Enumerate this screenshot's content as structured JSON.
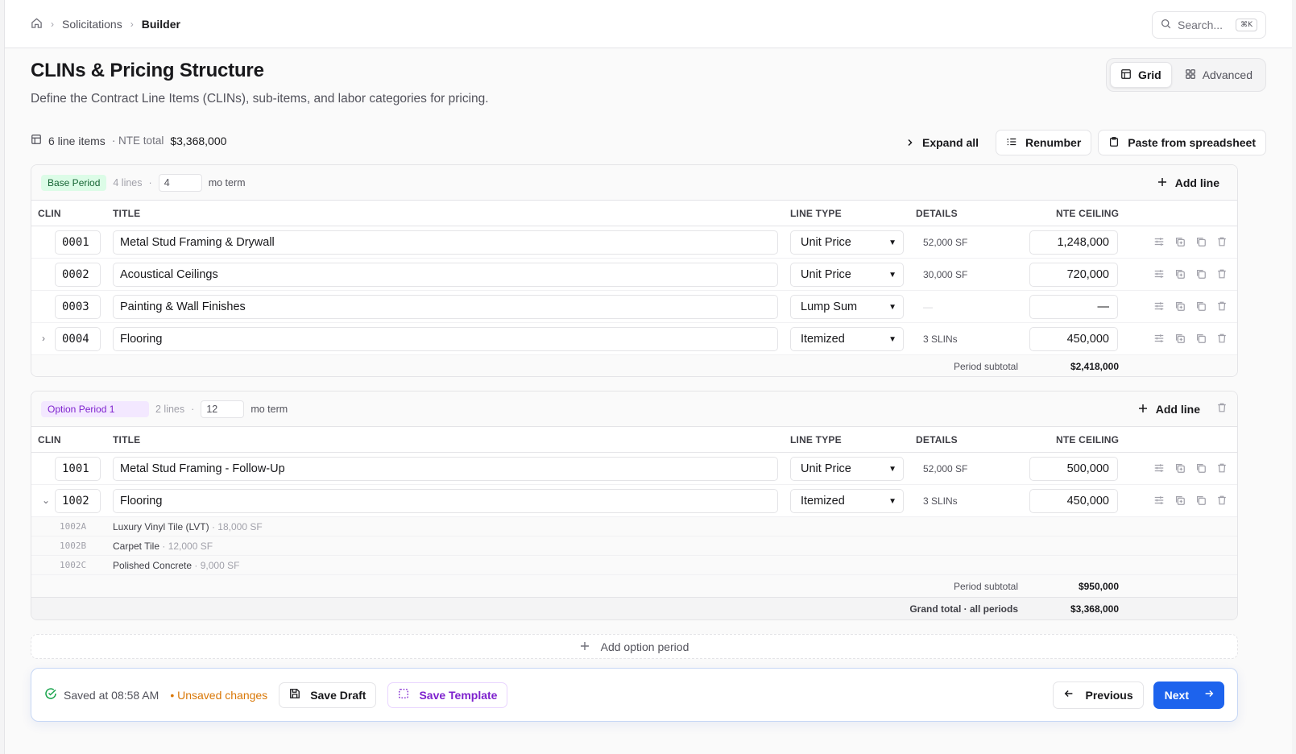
{
  "breadcrumbs": [
    "Solicitations",
    "Builder"
  ],
  "search": {
    "placeholder": "Search...",
    "shortcut": "⌘K"
  },
  "page": {
    "title": "CLINs & Pricing Structure",
    "subtitle": "Define the Contract Line Items (CLINs), sub-items, and labor categories for pricing."
  },
  "view_toggle": {
    "grid": "Grid",
    "advanced": "Advanced",
    "active": "grid"
  },
  "summary": {
    "line_items": "6 line items",
    "nte_label": "· NTE total",
    "nte_total": "$3,368,000"
  },
  "actions": {
    "expand_all": "Expand all",
    "renumber": "Renumber",
    "paste": "Paste from spreadsheet"
  },
  "columns": {
    "clin": "CLIN",
    "title": "TITLE",
    "line_type": "LINE TYPE",
    "details": "DETAILS",
    "nte": "NTE CEILING"
  },
  "base_period": {
    "label": "Base Period",
    "lines": "4 lines",
    "dot": "·",
    "term": "4",
    "term_unit": "mo term",
    "add_line": "Add line",
    "rows": [
      {
        "clin": "0001",
        "title": "Metal Stud Framing & Drywall",
        "line_type": "Unit Price",
        "details": "52,000 SF",
        "nte": "1,248,000"
      },
      {
        "clin": "0002",
        "title": "Acoustical Ceilings",
        "line_type": "Unit Price",
        "details": "30,000 SF",
        "nte": "720,000"
      },
      {
        "clin": "0003",
        "title": "Painting & Wall Finishes",
        "line_type": "Lump Sum",
        "details": "—",
        "nte": "—"
      },
      {
        "clin": "0004",
        "title": "Flooring",
        "line_type": "Itemized",
        "details": "3 SLINs",
        "nte": "450,000"
      }
    ],
    "subtotal_label": "Period subtotal",
    "subtotal": "$2,418,000"
  },
  "option_period": {
    "label": "Option Period 1",
    "lines": "2 lines",
    "dot": "·",
    "term": "12",
    "term_unit": "mo term",
    "add_line": "Add line",
    "rows": [
      {
        "clin": "1001",
        "title": "Metal Stud Framing - Follow-Up",
        "line_type": "Unit Price",
        "details": "52,000 SF",
        "nte": "500,000"
      },
      {
        "clin": "1002",
        "title": "Flooring",
        "line_type": "Itemized",
        "details": "3 SLINs",
        "nte": "450,000"
      }
    ],
    "slins": [
      {
        "code": "1002A",
        "name": "Luxury Vinyl Tile (LVT)",
        "qty": "· 18,000 SF"
      },
      {
        "code": "1002B",
        "name": "Carpet Tile",
        "qty": "· 12,000 SF"
      },
      {
        "code": "1002C",
        "name": "Polished Concrete",
        "qty": "· 9,000 SF"
      }
    ],
    "subtotal_label": "Period subtotal",
    "subtotal": "$950,000",
    "grand_label": "Grand total · all periods",
    "grand_total": "$3,368,000"
  },
  "add_option_period": "Add option period",
  "footer": {
    "saved": "Saved at 08:58 AM",
    "unsaved": "• Unsaved changes",
    "save_draft": "Save Draft",
    "save_template": "Save Template",
    "previous": "Previous",
    "next": "Next"
  },
  "colors": {
    "accent": "#1d63ed",
    "base_pill": "#dcfce7",
    "option_pill": "#f3e8ff",
    "unsaved": "#d97706",
    "saved_check": "#16a34a"
  }
}
